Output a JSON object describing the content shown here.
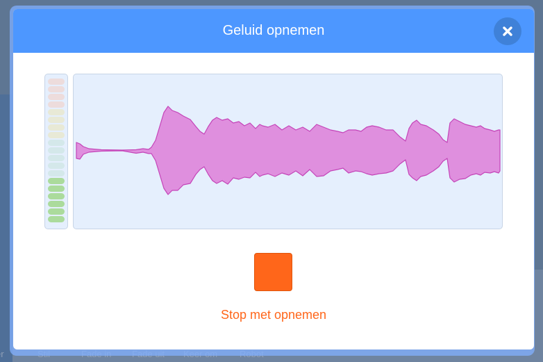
{
  "modal": {
    "title": "Geluid opnemen",
    "close_icon": "close-icon",
    "stop_label": "Stop met opnemen"
  },
  "level_meter": {
    "segments": 19,
    "active_segments": 6,
    "colors": {
      "red_dim": "#eddcdc",
      "yellow_dim": "#e8e9d6",
      "blue_dim": "#d4e8ea",
      "green_active": "#abdb9c"
    }
  },
  "colors": {
    "header": "#4d97ff",
    "waveform_fill": "#df8fde",
    "waveform_stroke": "#c444b8",
    "stop": "#ff661a",
    "panel": "#e5effd"
  },
  "background_effects": [
    "er",
    "Stil",
    "Fade in",
    "Fade uit",
    "Keer om",
    "Robot"
  ]
}
